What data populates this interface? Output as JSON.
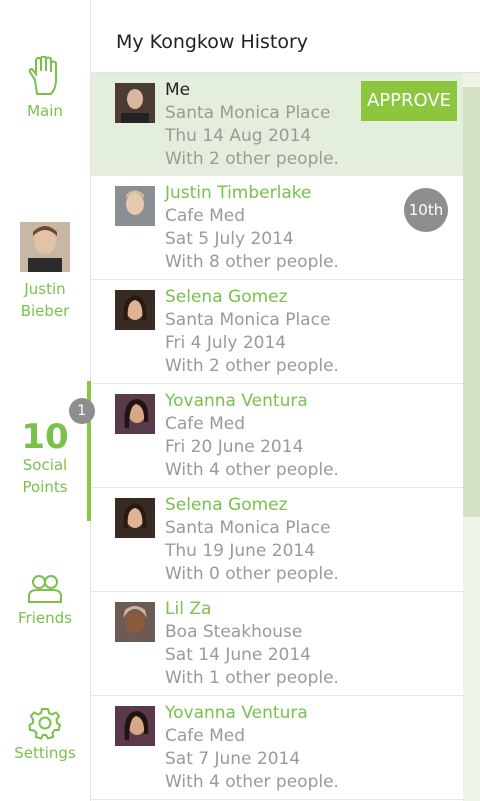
{
  "sidebar": {
    "main_label": "Main",
    "profile_name_line1": "Justin",
    "profile_name_line2": "Bieber",
    "points_value": "10",
    "points_badge": "1",
    "points_label_line1": "Social",
    "points_label_line2": "Points",
    "friends_label": "Friends",
    "settings_label": "Settings"
  },
  "header": {
    "title": "My Kongkow History"
  },
  "colors": {
    "accent": "#8cc63f",
    "text_green": "#7ac04c",
    "highlight_row": "#e4eedd",
    "badge_gray": "#8e8e8e"
  },
  "history": [
    {
      "name": "Me",
      "place": "Santa Monica Place",
      "date": "Thu 14 Aug 2014",
      "people": "With 2 other people.",
      "action": "APPROVE"
    },
    {
      "name": "Justin Timberlake",
      "place": "Cafe Med",
      "date": "Sat 5 July 2014",
      "people": "With 8 other people.",
      "rank": "10th"
    },
    {
      "name": "Selena Gomez",
      "place": "Santa Monica Place",
      "date": "Fri 4 July 2014",
      "people": "With 2 other people."
    },
    {
      "name": "Yovanna Ventura",
      "place": "Cafe Med",
      "date": "Fri 20 June 2014",
      "people": "With 4 other people."
    },
    {
      "name": "Selena Gomez",
      "place": "Santa Monica Place",
      "date": "Thu 19 June 2014",
      "people": "With 0 other people."
    },
    {
      "name": "Lil Za",
      "place": "Boa Steakhouse",
      "date": "Sat 14 June 2014",
      "people": "With 1 other people."
    },
    {
      "name": "Yovanna Ventura",
      "place": "Cafe Med",
      "date": "Sat 7 June 2014",
      "people": "With 4 other people."
    }
  ]
}
